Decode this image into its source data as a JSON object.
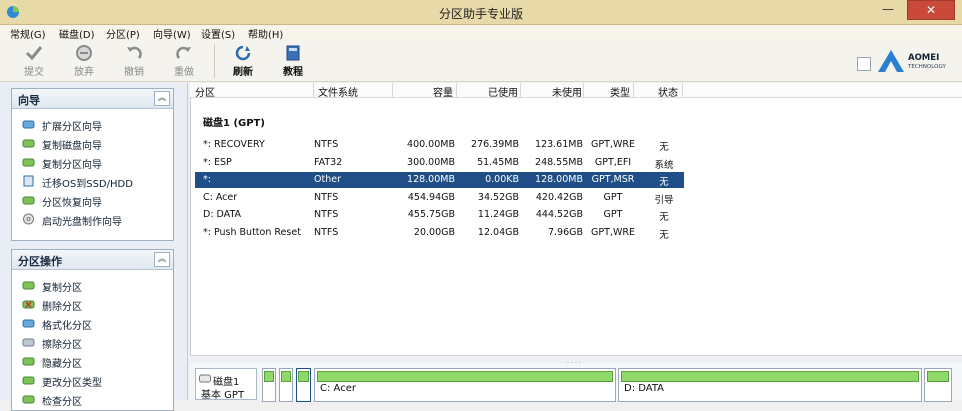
{
  "window": {
    "title": "分区助手专业版",
    "minimize": "—",
    "close": "✕"
  },
  "menu": [
    "常规(G)",
    "磁盘(D)",
    "分区(P)",
    "向导(W)",
    "设置(S)",
    "帮助(H)"
  ],
  "toolbar": {
    "items": [
      {
        "label": "提交",
        "icon": "check-icon",
        "enabled": false
      },
      {
        "label": "放弃",
        "icon": "discard-icon",
        "enabled": false
      },
      {
        "label": "撤销",
        "icon": "undo-icon",
        "enabled": false
      },
      {
        "label": "重做",
        "icon": "redo-icon",
        "enabled": false
      },
      {
        "label": "刷新",
        "icon": "refresh-icon",
        "enabled": true
      },
      {
        "label": "教程",
        "icon": "book-icon",
        "enabled": true
      }
    ]
  },
  "logo": {
    "line1": "AOMEI",
    "line2": "TECHNOLOGY"
  },
  "wizard_panel": {
    "title": "向导",
    "items": [
      "扩展分区向导",
      "复制磁盘向导",
      "复制分区向导",
      "迁移OS到SSD/HDD",
      "分区恢复向导",
      "启动光盘制作向导"
    ]
  },
  "ops_panel": {
    "title": "分区操作",
    "items": [
      "复制分区",
      "删除分区",
      "格式化分区",
      "擦除分区",
      "隐藏分区",
      "更改分区类型",
      "检查分区"
    ]
  },
  "table": {
    "columns": [
      "分区",
      "文件系统",
      "容量",
      "已使用",
      "未使用",
      "类型",
      "状态"
    ],
    "disk_label": "磁盘1 (GPT)",
    "rows": [
      {
        "partition": "*: RECOVERY",
        "fs": "NTFS",
        "capacity": "400.00MB",
        "used": "276.39MB",
        "free": "123.61MB",
        "type": "GPT,WRE",
        "status": "无",
        "selected": false
      },
      {
        "partition": "*: ESP",
        "fs": "FAT32",
        "capacity": "300.00MB",
        "used": "51.45MB",
        "free": "248.55MB",
        "type": "GPT,EFI",
        "status": "系统",
        "selected": false
      },
      {
        "partition": "*:",
        "fs": "Other",
        "capacity": "128.00MB",
        "used": "0.00KB",
        "free": "128.00MB",
        "type": "GPT,MSR",
        "status": "无",
        "selected": true
      },
      {
        "partition": "C: Acer",
        "fs": "NTFS",
        "capacity": "454.94GB",
        "used": "34.52GB",
        "free": "420.42GB",
        "type": "GPT",
        "status": "引导",
        "selected": false
      },
      {
        "partition": "D: DATA",
        "fs": "NTFS",
        "capacity": "455.75GB",
        "used": "11.24GB",
        "free": "444.52GB",
        "type": "GPT",
        "status": "无",
        "selected": false
      },
      {
        "partition": "*: Push Button Reset",
        "fs": "NTFS",
        "capacity": "20.00GB",
        "used": "12.04GB",
        "free": "7.96GB",
        "type": "GPT,WRE",
        "status": "无",
        "selected": false
      }
    ]
  },
  "diskmap": {
    "disk_name": "磁盘1",
    "disk_type": "基本 GPT",
    "segments": [
      {
        "label": "C: Acer"
      },
      {
        "label": "D: DATA"
      }
    ]
  },
  "colors": {
    "accent": "#1f4f86",
    "bar_fill": "#8fd86a",
    "title_bar": "#e8d9a8"
  }
}
